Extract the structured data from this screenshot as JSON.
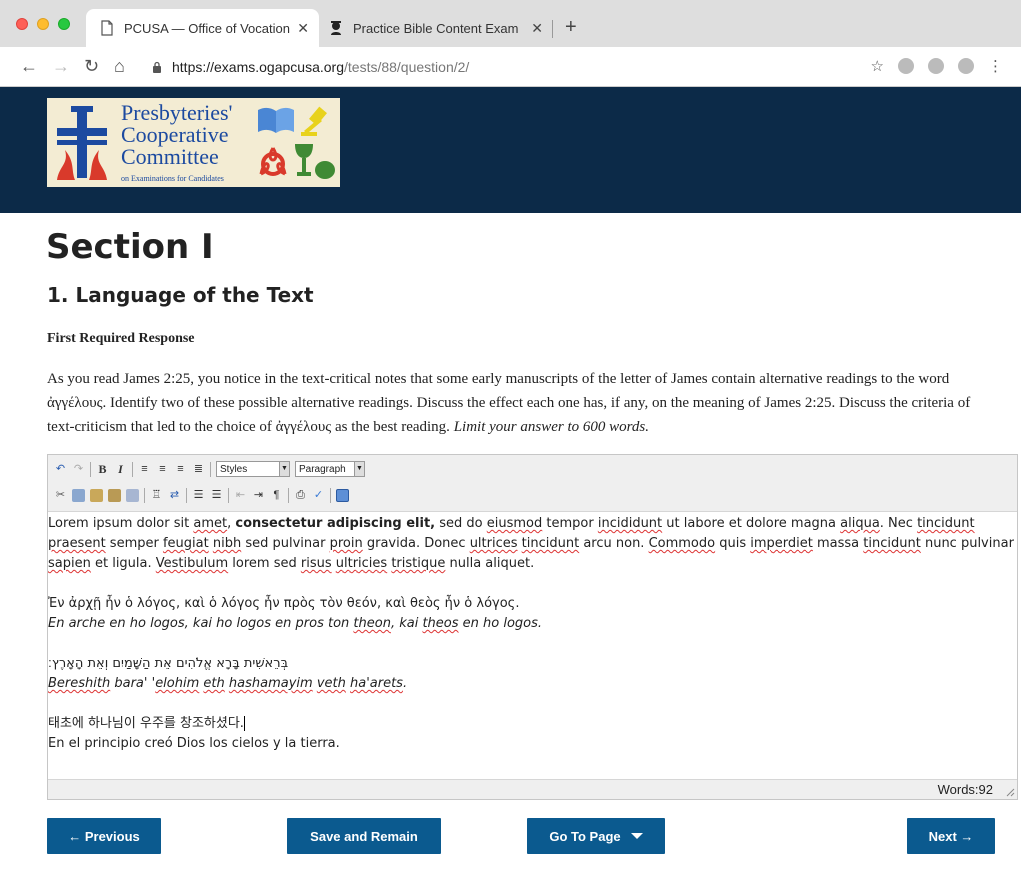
{
  "browser": {
    "tabs": [
      {
        "title": "PCUSA — Office of Vocation — ",
        "close": "✕",
        "active": true
      },
      {
        "title": "Practice Bible Content Exam",
        "close": "✕",
        "active": false
      }
    ],
    "new_tab": "+",
    "url_host": "https://exams.ogapcusa.org",
    "url_path": "/tests/88/question/2/"
  },
  "logo": {
    "line1": "Presbyteries'",
    "line2": "Cooperative",
    "line3": "Committee",
    "tagline": "on Examinations for Candidates",
    "colors": {
      "blue": "#1c4aa0",
      "red": "#d93a2b",
      "green": "#3f8a34",
      "yellow": "#e8d21c"
    }
  },
  "page": {
    "section_title": "Section I",
    "question_title": "1. Language of the Text",
    "response_label": "First Required Response",
    "prompt_main": "As you read James 2:25, you notice in the text-critical notes that some early manuscripts of the letter of James contain alternative readings to the word ἀγγέλους. Identify two of these possible alternative readings. Discuss the effect each one has, if any, on the meaning of James 2:25. Discuss the criteria of text-criticism that led to the choice of ἀγγέλους as the best reading.",
    "prompt_limit": "Limit your answer to 600 words."
  },
  "editor": {
    "styles_select": "Styles",
    "format_select": "Paragraph",
    "word_count": "Words:92",
    "body": {
      "p1_a": "Lorem ipsum dolor sit ",
      "p1_amet": "amet",
      "p1_b": ", ",
      "p1_bold": "consectetur adipiscing elit,",
      "p1_c": " sed do ",
      "p1_eiusmod": "eiusmod",
      "p1_d": " tempor ",
      "p1_incididunt": "incididunt",
      "p1_e": " ut labore et dolore magna ",
      "p1_aliqua": "aliqua",
      "p1_f": ". Nec ",
      "p1_tincidunt": "tincidunt",
      "p1_g": " ",
      "p1_praesent": "praesent",
      "p1_h": " semper ",
      "p1_feugiat": "feugiat",
      "p1_i": " ",
      "p1_nibh": "nibh",
      "p1_j": " sed pulvinar ",
      "p1_proin": "proin",
      "p1_k": " gravida. Donec ",
      "p1_ultrices": "ultrices",
      "p1_l": " ",
      "p1_tincidunt2": "tincidunt",
      "p1_m": " arcu non. ",
      "p1_commodo": "Commodo",
      "p1_n": " quis ",
      "p1_imperdiet": "imperdiet",
      "p1_o": " massa ",
      "p1_tincidunt3": "tincidunt",
      "p1_p": " nunc pulvinar ",
      "p1_sapien": "sapien",
      "p1_q": " et ligula. ",
      "p1_vestibulum": "Vestibulum",
      "p1_r": " lorem sed ",
      "p1_risus": "risus",
      "p1_s": " ",
      "p1_ultricies": "ultricies",
      "p1_t": " ",
      "p1_tristique": "tristique",
      "p1_u": " nulla aliquet.",
      "greek": "Ἐν ἀρχῇ ἦν ὁ λόγος, καὶ ὁ λόγος ἦν πρὸς τὸν θεόν, καὶ θεὸς ἦν ὁ λόγος.",
      "greek_translit_a": "En arche en ho logos, kai ho logos en pros ton ",
      "greek_translit_theon": "theon",
      "greek_translit_b": ", kai ",
      "greek_translit_theos": "theos",
      "greek_translit_c": " en ho logos.",
      "hebrew": "בְּרֵאשִׁית בָּרָא אֱלֹהִים אֵת הַשָּׁמַיִם וְאֵת הָאָרֶץ׃",
      "hebrew_translit_bereshith": "Bereshith",
      "hebrew_translit_a": " bara' '",
      "hebrew_translit_elohim": "elohim",
      "hebrew_translit_b": " ",
      "hebrew_translit_eth": "eth",
      "hebrew_translit_c": " ",
      "hebrew_translit_hashamayim": "hashamayim",
      "hebrew_translit_d": " ",
      "hebrew_translit_veth": "veth",
      "hebrew_translit_e": " ",
      "hebrew_translit_haarets": "ha'arets",
      "hebrew_translit_f": ".",
      "korean": "태초에 하나님이 우주를 창조하셨다.",
      "spanish": "En el principio creó Dios los cielos y la tierra."
    }
  },
  "buttons": {
    "previous": "← Previous",
    "save": "Save and Remain",
    "goto": "Go To Page",
    "next": "Next →"
  },
  "colors": {
    "header_bg": "#0c2a48",
    "button_bg": "#0b5a8f",
    "squiggle": "#d33"
  }
}
